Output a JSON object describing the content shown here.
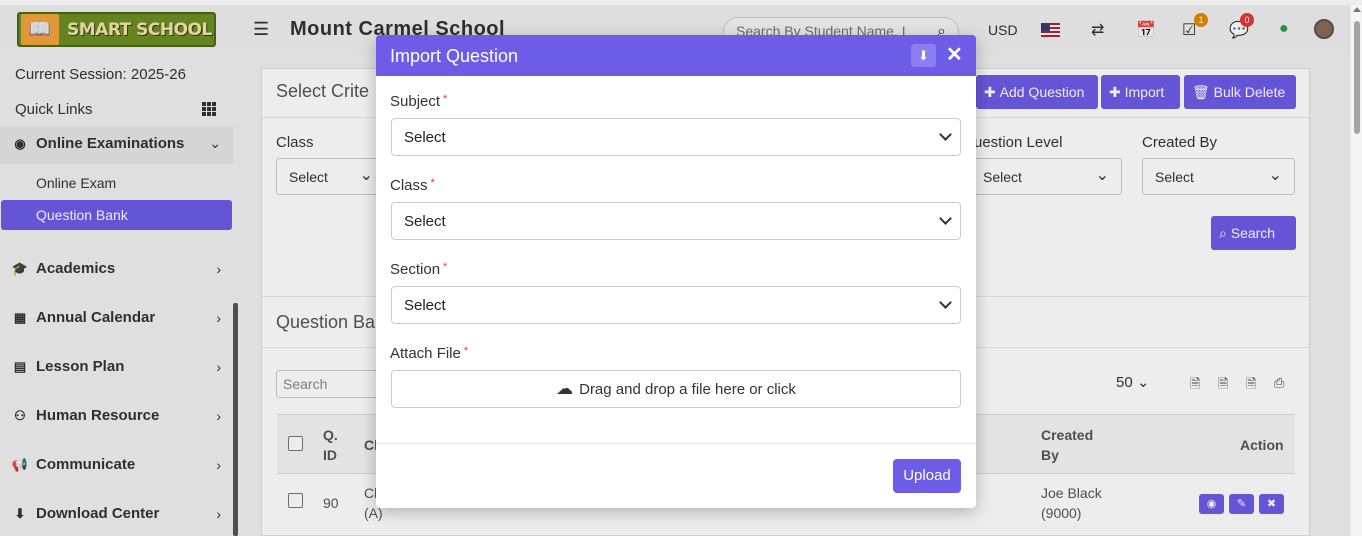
{
  "header": {
    "logo_text": "SMART SCHOOL",
    "school_name": "Mount Carmel School",
    "search_placeholder": "Search By Student Name, I",
    "currency": "USD",
    "task_count": "1",
    "chat_count": "0"
  },
  "sidebar": {
    "session": "Current Session: 2025-26",
    "quick_links": "Quick Links",
    "active_group": "Online Examinations",
    "sub_items": [
      "Online Exam",
      "Question Bank"
    ],
    "items": [
      "Academics",
      "Annual Calendar",
      "Lesson Plan",
      "Human Resource",
      "Communicate",
      "Download Center"
    ]
  },
  "main": {
    "criteria_title": "Select Crite",
    "add_question": "Add Question",
    "import": "Import",
    "bulk_delete": "Bulk Delete",
    "filters": {
      "class_label": "Class",
      "class_value": "Select",
      "level_label": "uestion Level",
      "level_value": "Select",
      "created_label": "Created By",
      "created_value": "Select"
    },
    "search_button": "Search",
    "bank_title": "Question Ba",
    "table_search_placeholder": "Search",
    "per_page": "50",
    "columns": [
      "Q.\nID",
      "Cl",
      "Created\nBy",
      "Action"
    ],
    "row": {
      "id": "90",
      "class": "Cl\n(A)",
      "created_by": "Joe Black\n(9000)"
    }
  },
  "modal": {
    "title": "Import Question",
    "subject_label": "Subject",
    "subject_value": "Select",
    "class_label": "Class",
    "class_value": "Select",
    "section_label": "Section",
    "section_value": "Select",
    "file_label": "Attach File",
    "dropzone_text": "Drag and drop a file here or click",
    "required_mark": "*",
    "upload": "Upload"
  },
  "colors": {
    "accent": "#6c5ce7",
    "required": "#e53935"
  }
}
